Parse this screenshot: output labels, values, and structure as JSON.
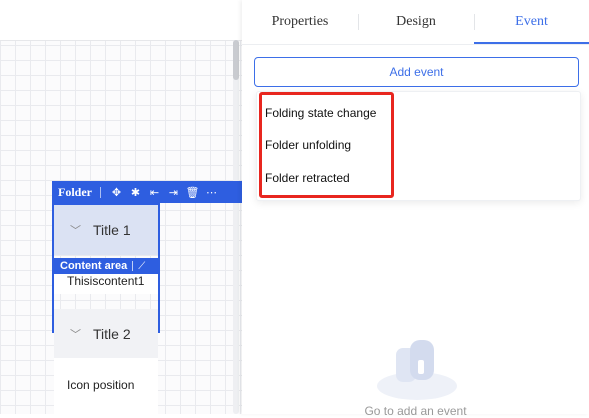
{
  "canvas": {
    "folder": {
      "toolbar_label": "Folder",
      "toolbar_icons": [
        "move-icon",
        "drag-icon",
        "align-left-icon",
        "align-right-icon",
        "delete-icon",
        "more-icon"
      ],
      "panels": [
        {
          "title": "Title 1",
          "expanded": true
        },
        {
          "title": "Title 2",
          "expanded": false
        }
      ],
      "content_area_label": "Content area",
      "content_text": "Thisiscontent1",
      "icon_position_label": "Icon position"
    }
  },
  "inspector": {
    "tabs": [
      {
        "label": "Properties",
        "active": false
      },
      {
        "label": "Design",
        "active": false
      },
      {
        "label": "Event",
        "active": true
      }
    ],
    "add_event_label": "Add event",
    "event_options": [
      "Folding state change",
      "Folder unfolding",
      "Folder retracted"
    ],
    "empty_state_text": "Go to add an event"
  },
  "colors": {
    "accent": "#3d6fe8",
    "selection": "#2e5ee0",
    "highlight_box": "#e8261f"
  }
}
